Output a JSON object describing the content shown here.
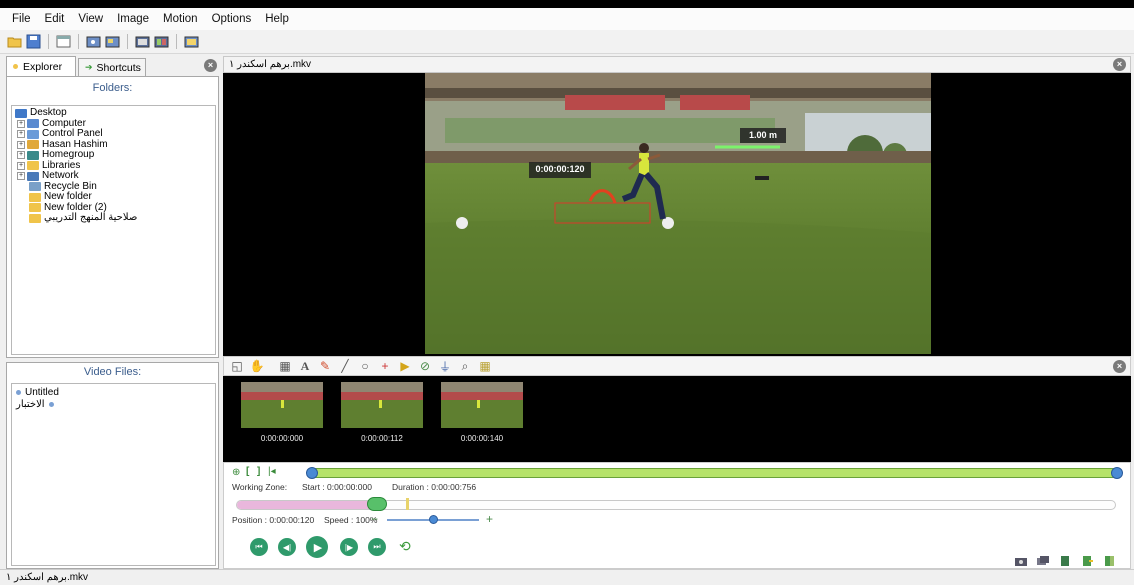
{
  "menu": {
    "items": [
      "File",
      "Edit",
      "View",
      "Image",
      "Motion",
      "Options",
      "Help"
    ]
  },
  "toolbar": {
    "icons": [
      "open-folder",
      "save",
      "window",
      "export-image",
      "export-video",
      "export-frames",
      "export-multi",
      "export-side-by-side"
    ]
  },
  "left": {
    "tabs": [
      "Explorer",
      "Shortcuts"
    ],
    "folders_title": "Folders:",
    "tree": [
      {
        "label": "Desktop",
        "icon": "desktop-icon",
        "expand": false,
        "indent": 0
      },
      {
        "label": "Computer",
        "icon": "computer-icon",
        "expand": true,
        "indent": 1
      },
      {
        "label": "Control Panel",
        "icon": "control-panel-icon",
        "expand": true,
        "indent": 1
      },
      {
        "label": "Hasan Hashim",
        "icon": "user-icon",
        "expand": true,
        "indent": 1
      },
      {
        "label": "Homegroup",
        "icon": "homegroup-icon",
        "expand": true,
        "indent": 1
      },
      {
        "label": "Libraries",
        "icon": "libraries-icon",
        "expand": true,
        "indent": 1
      },
      {
        "label": "Network",
        "icon": "network-icon",
        "expand": true,
        "indent": 1
      },
      {
        "label": "Recycle Bin",
        "icon": "recycle-bin-icon",
        "expand": false,
        "indent": 2
      },
      {
        "label": "New folder",
        "icon": "folder-icon",
        "expand": false,
        "indent": 2
      },
      {
        "label": "New folder (2)",
        "icon": "folder-icon",
        "expand": false,
        "indent": 2
      },
      {
        "label": "صلاحية المنهج التدريبي",
        "icon": "folder-icon",
        "expand": false,
        "indent": 2
      }
    ],
    "video_files_title": "Video Files:",
    "video_files": [
      "Untitled",
      "الاختبار"
    ]
  },
  "main": {
    "title": "برهم اسكندر ١.mkv",
    "overlay_time": "0:00:00:120",
    "overlay_distance": "1.00 m",
    "thumbnails": [
      "0:00:00:000",
      "0:00:00:112",
      "0:00:00:140"
    ],
    "working_zone": "Working Zone:",
    "start": "Start : 0:00:00:000",
    "duration": "Duration : 0:00:00:756",
    "position": "Position : 0:00:00:120",
    "speed": "Speed : 100%",
    "speed_fraction": 0.5,
    "position_fraction": 0.16
  },
  "status": {
    "text": "برهم اسكندر ١.mkv"
  },
  "colors": {
    "accent_green": "#2f9a6b",
    "timeline_green": "#b6e36a",
    "position_pink": "#e9b7dc"
  }
}
